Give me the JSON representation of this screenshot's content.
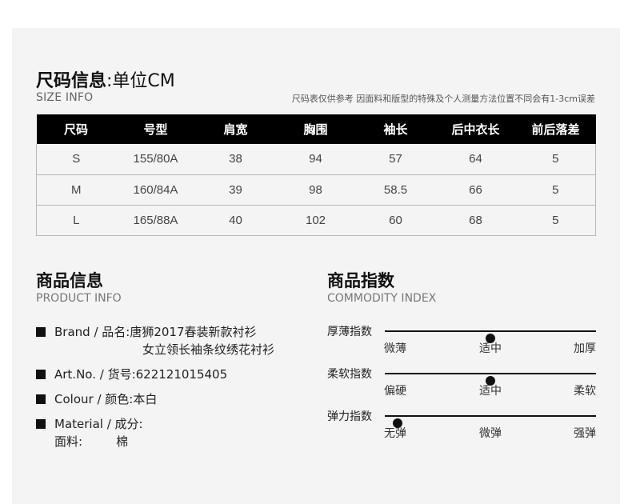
{
  "size_section": {
    "title_bold": "尺码信息",
    "title_rest": ":单位CM",
    "subtitle": "SIZE INFO",
    "note": "尺码表仅供参考 因面料和版型的特殊及个人测量方法位置不同会有1-3cm误差"
  },
  "size_table": {
    "headers": [
      "尺码",
      "号型",
      "肩宽",
      "胸围",
      "袖长",
      "后中衣长",
      "前后落差"
    ],
    "rows": [
      [
        "S",
        "155/80A",
        "38",
        "94",
        "57",
        "64",
        "5"
      ],
      [
        "M",
        "160/84A",
        "39",
        "98",
        "58.5",
        "66",
        "5"
      ],
      [
        "L",
        "165/88A",
        "40",
        "102",
        "60",
        "68",
        "5"
      ]
    ]
  },
  "product_info": {
    "title": "商品信息",
    "subtitle": "PRODUCT INFO",
    "brand": "Brand / 品名:唐狮2017春装新款衬衫",
    "brand_line2": "女立领长袖条纹绣花衬衫",
    "artno": "Art.No. / 货号:622121015405",
    "colour": "Colour / 颜色:本白",
    "material": "Material / 成分:",
    "fabric_label": "面料:",
    "fabric_value": "棉"
  },
  "commodity_index": {
    "title": "商品指数",
    "subtitle": "COMMODITY INDEX",
    "items": [
      {
        "label": "厚薄指数",
        "ticks": [
          "微薄",
          "适中",
          "加厚"
        ],
        "level": 0.5
      },
      {
        "label": "柔软指数",
        "ticks": [
          "偏硬",
          "适中",
          "柔软"
        ],
        "level": 0.5
      },
      {
        "label": "弹力指数",
        "ticks": [
          "无弹",
          "微弹",
          "强弹"
        ],
        "level": 0.06
      }
    ]
  }
}
